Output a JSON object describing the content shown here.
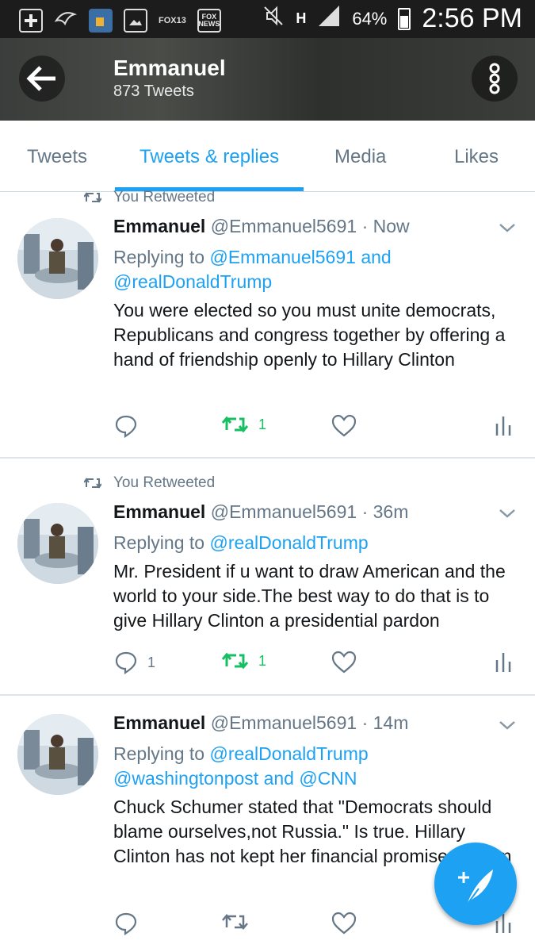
{
  "status_bar": {
    "battery": "64%",
    "time": "2:56 PM",
    "icons": [
      "plus-icon",
      "bird-icon",
      "cup-icon",
      "image-icon",
      "fox13-icon",
      "foxnews-icon",
      "mute-icon",
      "h-network-icon",
      "signal-icon",
      "battery-icon"
    ],
    "fox13_label": "FOX13",
    "foxnews_label": "FOX NEWS",
    "h_label": "H"
  },
  "header": {
    "name": "Emmanuel",
    "tweet_count": "873 Tweets"
  },
  "tabs": [
    {
      "label": "Tweets",
      "active": false
    },
    {
      "label": "Tweets & replies",
      "active": true
    },
    {
      "label": "Media",
      "active": false
    },
    {
      "label": "Likes",
      "active": false
    }
  ],
  "tweets": [
    {
      "retweeted_label": "You Retweeted",
      "name": "Emmanuel",
      "handle": "@Emmanuel5691",
      "time": "· Now",
      "replying_prefix": "Replying to",
      "replying_1": "@Emmanuel5691",
      "replying_and": "and",
      "replying_2": "@realDonaldTrump",
      "text": "You were elected so you must unite democrats, Republicans and congress together by offering a hand of friendship openly to Hillary Clinton",
      "reply_count": "",
      "retweet_count": "1",
      "like_count": ""
    },
    {
      "retweeted_label": "You Retweeted",
      "name": "Emmanuel",
      "handle": "@Emmanuel5691",
      "time": "· 36m",
      "replying_prefix": "Replying to",
      "replying_1": "@realDonaldTrump",
      "text": "Mr. President if u want to draw American and the world to your side.The best way to do that is to give Hillary Clinton a presidential pardon",
      "reply_count": "1",
      "retweet_count": "1",
      "like_count": ""
    },
    {
      "name": "Emmanuel",
      "handle": "@Emmanuel5691",
      "time": "· 14m",
      "replying_prefix": "Replying to",
      "replying_1": "@realDonaldTrump",
      "replying_2": "@washingtonpost",
      "replying_and": "and",
      "replying_3": "@CNN",
      "text": "Chuck Schumer stated that \"Democrats should blame ourselves,not Russia.\" Is true. Hillary Clinton has not kept her financial promises to him",
      "reply_count": "",
      "retweet_count": "",
      "like_count": ""
    }
  ],
  "colors": {
    "accent": "#1da1f2",
    "retweet_green": "#17bf63",
    "secondary_text": "#657786"
  }
}
